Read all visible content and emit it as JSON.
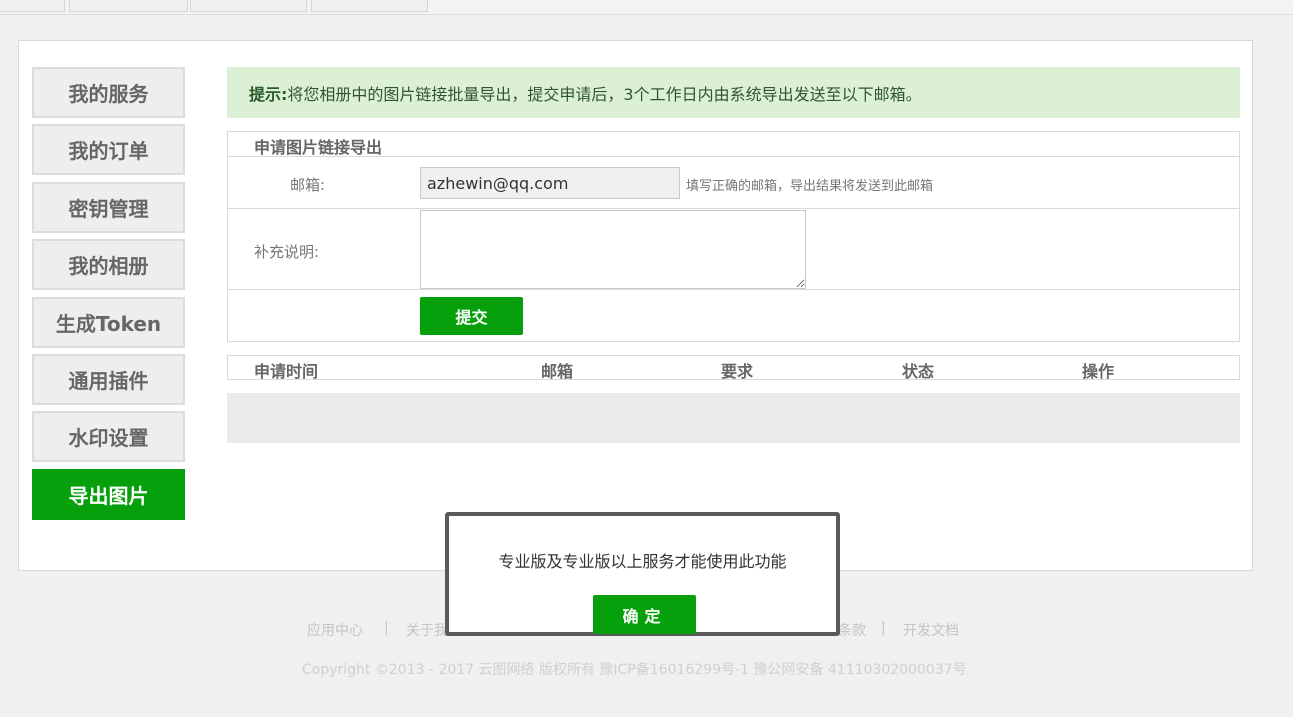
{
  "sidebar": {
    "items": [
      {
        "label": "我的服务"
      },
      {
        "label": "我的订单"
      },
      {
        "label": "密钥管理"
      },
      {
        "label": "我的相册"
      },
      {
        "label": "生成Token"
      },
      {
        "label": "通用插件"
      },
      {
        "label": "水印设置"
      },
      {
        "label": "导出图片",
        "active": true
      }
    ]
  },
  "tip": {
    "prefix": "提示:",
    "text": "将您相册中的图片链接批量导出，提交申请后，3个工作日内由系统导出发送至以下邮箱。"
  },
  "form": {
    "title": "申请图片链接导出",
    "email_label": "邮箱:",
    "email_value": "azhewin@qq.com",
    "email_hint": "填写正确的邮箱，导出结果将发送到此邮箱",
    "note_label": "补充说明:",
    "note_value": "",
    "submit_label": "提交"
  },
  "records": {
    "columns": [
      "申请时间",
      "邮箱",
      "要求",
      "状态",
      "操作"
    ],
    "rows": []
  },
  "footer": {
    "links": [
      "应用中心",
      "关于我",
      "条款",
      "开发文档"
    ],
    "separator": "|",
    "copyright": "Copyright ©2013 - 2017 云图网络 版权所有 豫ICP备16016299号-1 豫公网安备 41110302000037号"
  },
  "modal": {
    "message": "专业版及专业版以上服务才能使用此功能",
    "ok_label": "确定"
  },
  "colors": {
    "accent": "#05a00c",
    "tip_bg": "#dcf0d6"
  }
}
